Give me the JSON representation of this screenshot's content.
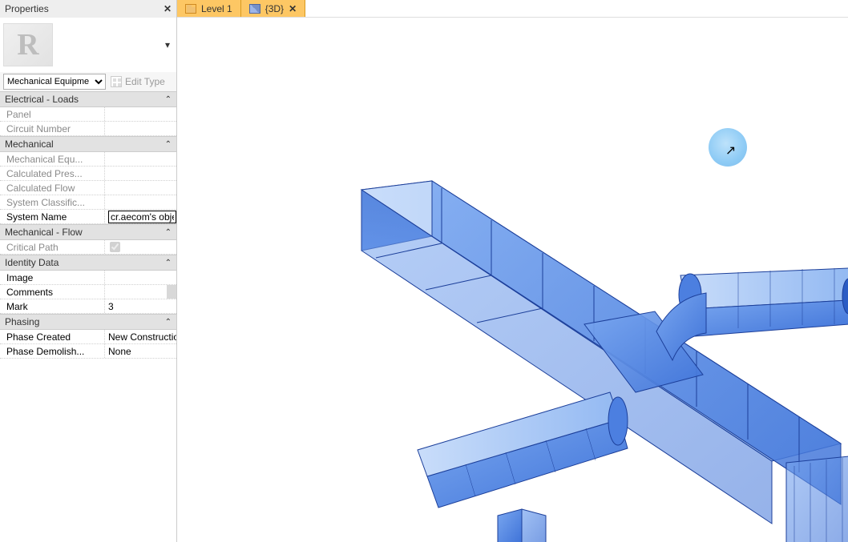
{
  "panel": {
    "title": "Properties",
    "type_selected": "Mechanical Equipme",
    "edit_type_label": "Edit Type",
    "thumb_letter": "R",
    "sections": {
      "elec_loads": "Electrical - Loads",
      "mech": "Mechanical",
      "mech_flow": "Mechanical - Flow",
      "identity": "Identity Data",
      "phasing": "Phasing"
    },
    "rows": {
      "panel_name": "Panel",
      "circuit_no": "Circuit Number",
      "mech_eq": "Mechanical Equ...",
      "calc_pres": "Calculated Pres...",
      "calc_flow": "Calculated Flow",
      "sys_class": "System Classific...",
      "sys_name_label": "System Name",
      "sys_name_value": "cr.aecom's obje",
      "critical_path": "Critical Path",
      "image": "Image",
      "comments": "Comments",
      "mark_label": "Mark",
      "mark_value": "3",
      "phase_created_label": "Phase Created",
      "phase_created_value": "New Construction",
      "phase_demo_label": "Phase Demolish...",
      "phase_demo_value": "None"
    }
  },
  "tabs": [
    {
      "label": "Level 1",
      "icon": "plan",
      "active": false
    },
    {
      "label": "{3D}",
      "icon": "cube",
      "active": true
    }
  ]
}
